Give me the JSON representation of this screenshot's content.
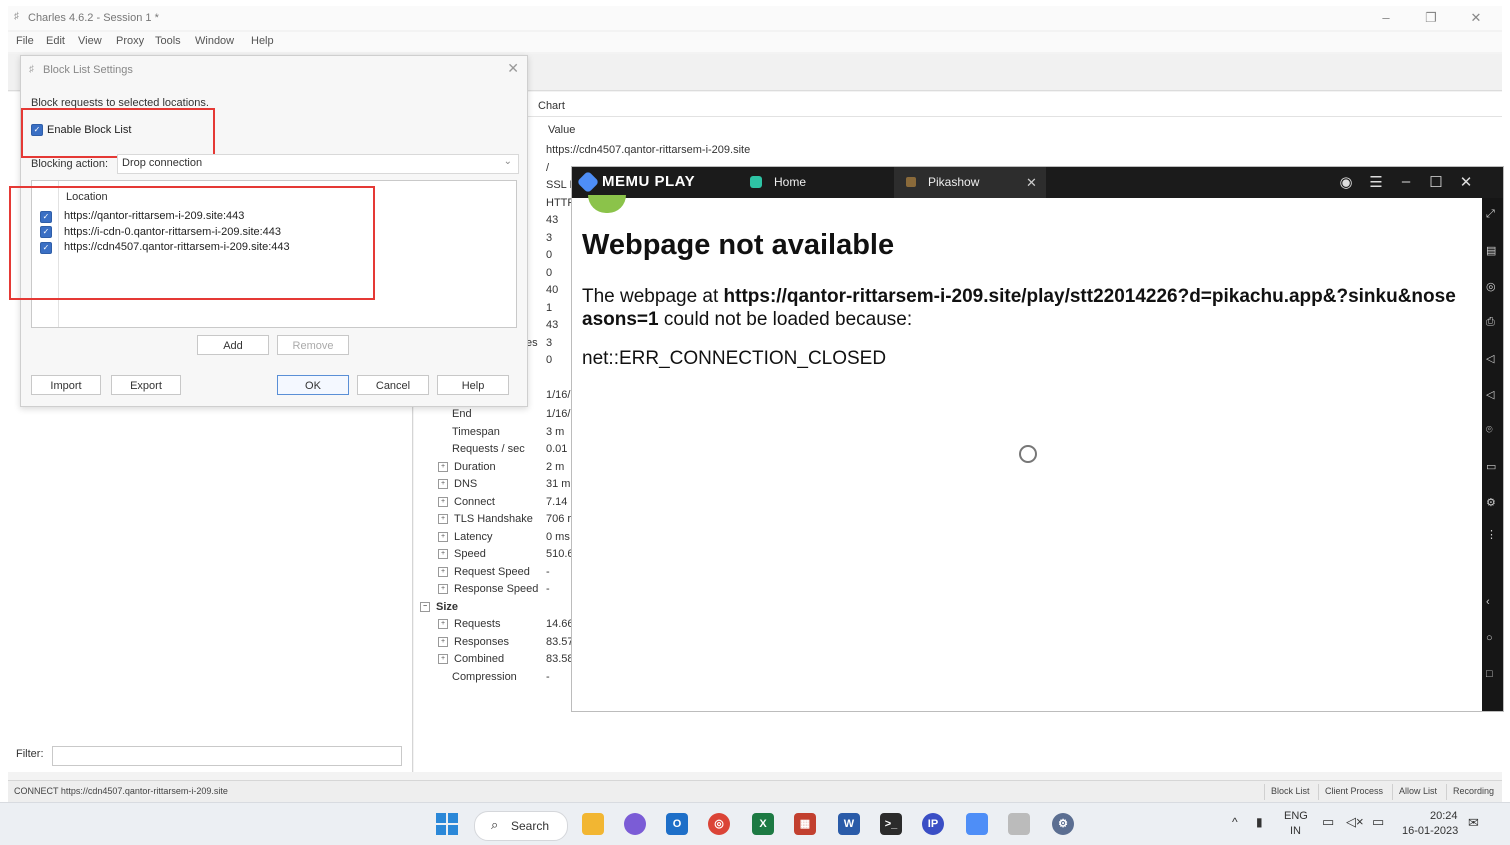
{
  "charles": {
    "title": "Charles 4.6.2 - Session 1 *",
    "menu": [
      "File",
      "Edit",
      "View",
      "Proxy",
      "Tools",
      "Window",
      "Help"
    ],
    "right_header": {
      "col1": "Chart",
      "col2": "Value"
    },
    "first_value": "https://cdn4507.qantor-rittarsem-i-209.site",
    "values_top": [
      "/",
      "SSL P",
      "HTTP",
      "43",
      "3",
      "0",
      "0",
      "40",
      "1",
      "43",
      "3",
      "0"
    ],
    "partial_label": "es",
    "tree": [
      {
        "label": "End",
        "value": "1/16/",
        "pm": false
      },
      {
        "label": "Timespan",
        "value": "3 m",
        "pm": false
      },
      {
        "label": "Requests / sec",
        "value": "0.01",
        "pm": false
      },
      {
        "label": "Duration",
        "value": "2 m",
        "pm": true
      },
      {
        "label": "DNS",
        "value": "31 m",
        "pm": true
      },
      {
        "label": "Connect",
        "value": "7.14",
        "pm": true
      },
      {
        "label": "TLS Handshake",
        "value": "706 r",
        "pm": true
      },
      {
        "label": "Latency",
        "value": "0 ms",
        "pm": true
      },
      {
        "label": "Speed",
        "value": "510.6",
        "pm": true
      },
      {
        "label": "Request Speed",
        "value": "-",
        "pm": true
      },
      {
        "label": "Response Speed",
        "value": "-",
        "pm": true
      }
    ],
    "size_label": "Size",
    "size_tree": [
      {
        "label": "Requests",
        "value": "14.66",
        "pm": true
      },
      {
        "label": "Responses",
        "value": "83.57",
        "pm": true
      },
      {
        "label": "Combined",
        "value": "83.58",
        "pm": true
      },
      {
        "label": "Compression",
        "value": "-",
        "pm": false
      }
    ],
    "start_value": "1/16/",
    "filter_label": "Filter:",
    "status_text": "CONNECT https://cdn4507.qantor-rittarsem-i-209.site",
    "status_buttons": [
      "Block List",
      "Client Process",
      "Allow List",
      "Recording"
    ]
  },
  "dialog": {
    "title": "Block List Settings",
    "description": "Block requests to selected locations.",
    "enable_label": "Enable Block List",
    "blocking_action_label": "Blocking action:",
    "blocking_action_value": "Drop connection",
    "location_header": "Location",
    "locations": [
      "https://qantor-rittarsem-i-209.site:443",
      "https://i-cdn-0.qantor-rittarsem-i-209.site:443",
      "https://cdn4507.qantor-rittarsem-i-209.site:443"
    ],
    "buttons": {
      "add": "Add",
      "remove": "Remove",
      "import": "Import",
      "export": "Export",
      "ok": "OK",
      "cancel": "Cancel",
      "help": "Help"
    }
  },
  "memu": {
    "brand": "MEMU PLAY",
    "tab_home": "Home",
    "tab_pikashow": "Pikashow",
    "error_title": "Webpage not available",
    "error_prefix": "The webpage at ",
    "error_url": "https://qantor-rittarsem-i-209.site/play/stt22014226?d=pikachu.app&?sinku&noseasons=1",
    "error_suffix": " could not be loaded because:",
    "error_code": "net::ERR_CONNECTION_CLOSED"
  },
  "taskbar": {
    "search_label": "Search",
    "lang": "ENG",
    "region": "IN",
    "time": "20:24",
    "date": "16-01-2023"
  },
  "colors": {
    "highlight_red": "#e53935",
    "memu_bar": "#1b1b1b",
    "checkbox_blue": "#3a6fc4"
  }
}
